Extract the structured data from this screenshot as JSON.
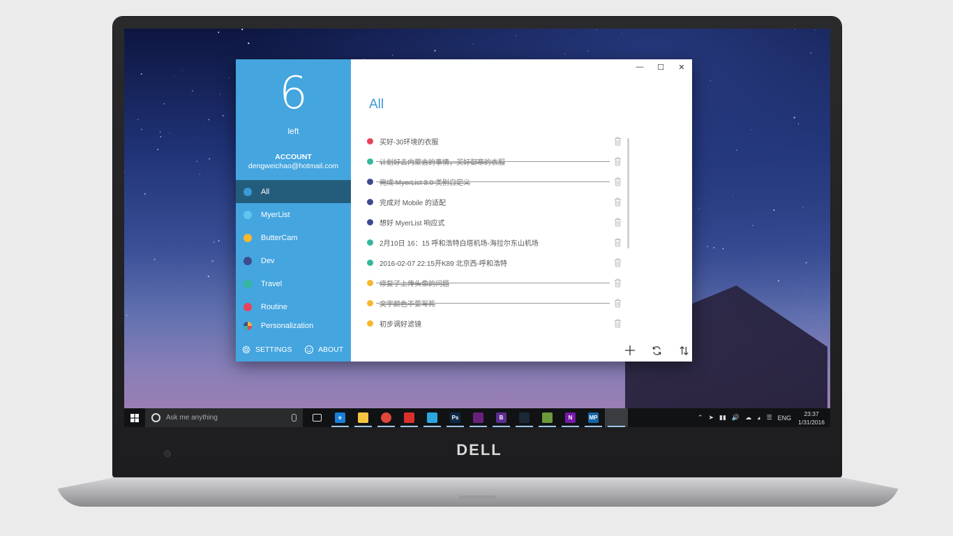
{
  "brand": "DELL",
  "sidebar": {
    "count": "6",
    "count_label": "left",
    "account_title": "ACCOUNT",
    "account_email": "dengweichao@hotmail.com",
    "categories": [
      {
        "label": "All",
        "color": "#3a9ad8",
        "active": true
      },
      {
        "label": "MyerList",
        "color": "#60c5f1"
      },
      {
        "label": "ButterCam",
        "color": "#f7b72e"
      },
      {
        "label": "Dev",
        "color": "#3d4b8f"
      },
      {
        "label": "Travel",
        "color": "#35b79d"
      },
      {
        "label": "Routine",
        "color": "#e8435a"
      },
      {
        "label": "Personalization",
        "icon": "palette-pie-icon"
      }
    ],
    "settings_label": "SETTINGS",
    "about_label": "ABOUT"
  },
  "main": {
    "title": "All",
    "todos": [
      {
        "text": "买好-30环境的衣服",
        "color": "#e8435a",
        "done": false
      },
      {
        "text": "计划好去内蒙古的事情，买好御寒的衣服",
        "color": "#35b79d",
        "done": true
      },
      {
        "text": "完成 MyerList 3.0 类别自定义",
        "color": "#3d4b8f",
        "done": true
      },
      {
        "text": "完成对 Mobile 的适配",
        "color": "#3d4b8f",
        "done": false
      },
      {
        "text": "想好 MyerList 响应式",
        "color": "#3d4b8f",
        "done": false
      },
      {
        "text": "2月10日 16：15 呼和浩特白塔机场-海拉尔东山机场",
        "color": "#35b79d",
        "done": false
      },
      {
        "text": "2016-02-07 22:15开K89 北京西-呼和浩特",
        "color": "#35b79d",
        "done": false
      },
      {
        "text": "修复了上传头像的问题",
        "color": "#f7b72e",
        "done": true
      },
      {
        "text": "文字颜色不要写死",
        "color": "#f7b72e",
        "done": true
      },
      {
        "text": "初步调好滤镜",
        "color": "#f7b72e",
        "done": false
      }
    ]
  },
  "taskbar": {
    "search_placeholder": "Ask me anything",
    "apps": [
      {
        "name": "task-view",
        "label": "",
        "color": "#111214"
      },
      {
        "name": "edge",
        "label": "e",
        "color": "#1a7fd6"
      },
      {
        "name": "file-explorer",
        "label": "",
        "color": "#f5c542"
      },
      {
        "name": "chrome",
        "label": "",
        "color": "#e0473a"
      },
      {
        "name": "netease-music",
        "label": "",
        "color": "#d9302c"
      },
      {
        "name": "telegram",
        "label": "",
        "color": "#2ca5e0"
      },
      {
        "name": "photoshop",
        "label": "Ps",
        "color": "#0d2a46"
      },
      {
        "name": "visual-studio",
        "label": "",
        "color": "#68217a"
      },
      {
        "name": "blend",
        "label": "B",
        "color": "#5b2d91"
      },
      {
        "name": "steam",
        "label": "",
        "color": "#1b2838"
      },
      {
        "name": "android-studio",
        "label": "",
        "color": "#6a9a3b"
      },
      {
        "name": "onenote",
        "label": "N",
        "color": "#7719aa"
      },
      {
        "name": "mp",
        "label": "MP",
        "color": "#1565a8"
      },
      {
        "name": "myerlist",
        "label": "",
        "color": "#3b3c3f"
      }
    ],
    "language": "ENG",
    "time": "23:37",
    "date": "1/31/2016"
  }
}
